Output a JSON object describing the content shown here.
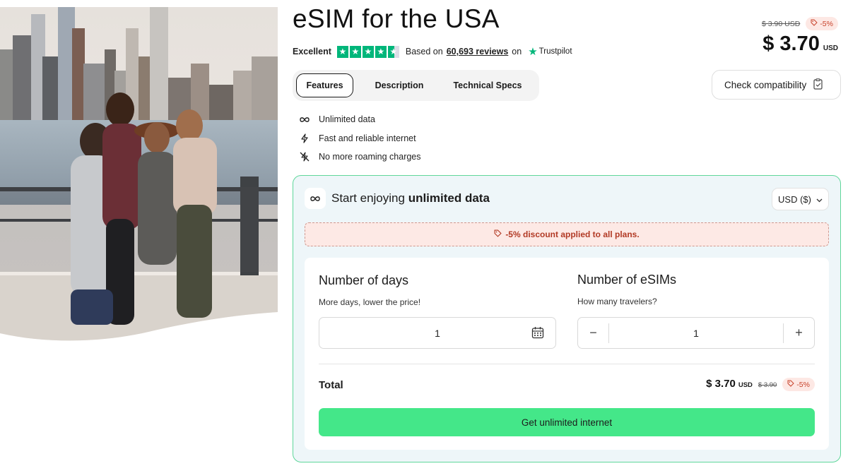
{
  "header": {
    "title": "eSIM for the USA",
    "rating_word": "Excellent",
    "based_on": "Based on",
    "reviews_count": "60,693 reviews",
    "on": "on",
    "trustpilot": "Trustpilot",
    "trustpilot_stars": 4.5
  },
  "pricing": {
    "old_price": "$ 3.90 USD",
    "discount_badge": "-5%",
    "price": "$ 3.70",
    "currency": "USD"
  },
  "tabs": [
    {
      "label": "Features",
      "active": true
    },
    {
      "label": "Description",
      "active": false
    },
    {
      "label": "Technical Specs",
      "active": false
    }
  ],
  "check_compatibility": "Check compatibility",
  "features": [
    {
      "icon": "infinity-icon",
      "label": "Unlimited data"
    },
    {
      "icon": "lightning-icon",
      "label": "Fast and reliable internet"
    },
    {
      "icon": "no-roaming-icon",
      "label": "No more roaming charges"
    }
  ],
  "plan": {
    "title_prefix": "Start enjoying",
    "title_bold": "unlimited data",
    "currency_select": "USD ($)",
    "discount_banner": "-5% discount applied to all plans.",
    "days": {
      "title": "Number of days",
      "subtitle": "More days, lower the price!",
      "value": "1"
    },
    "esims": {
      "title": "Number of eSIMs",
      "subtitle": "How many travelers?",
      "value": "1",
      "minus": "−",
      "plus": "+"
    },
    "total": {
      "label": "Total",
      "price": "$ 3.70",
      "currency": "USD",
      "old_price": "$ 3.90",
      "badge": "-5%"
    },
    "cta": "Get unlimited internet"
  },
  "colors": {
    "accent_green": "#44e789",
    "panel_border": "#5fd79a",
    "discount_red": "#c8432b",
    "trustpilot_green": "#00b67a"
  }
}
